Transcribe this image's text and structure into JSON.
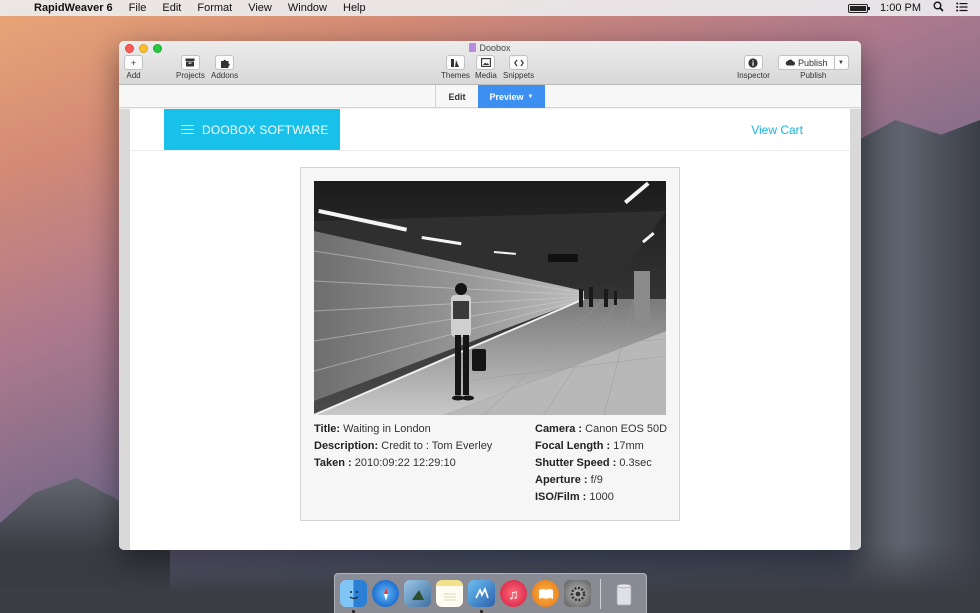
{
  "menubar": {
    "app_name": "RapidWeaver 6",
    "items": [
      "File",
      "Edit",
      "Format",
      "View",
      "Window",
      "Help"
    ],
    "clock": "1:00 PM"
  },
  "window": {
    "title": "Doobox",
    "toolbar": {
      "add": "Add",
      "projects": "Projects",
      "addons": "Addons",
      "themes": "Themes",
      "media": "Media",
      "snippets": "Snippets",
      "inspector": "Inspector",
      "publish_button": "Publish",
      "publish_label": "Publish"
    },
    "modes": {
      "edit": "Edit",
      "preview": "Preview"
    }
  },
  "site": {
    "brand": "DOOBOX SOFTWARE",
    "view_cart": "View Cart",
    "photo": {
      "title_label": "Title:",
      "title": "Waiting in London",
      "description_label": "Description:",
      "description": "Credit to : Tom Everley",
      "taken_label": "Taken :",
      "taken": "2010:09:22 12:29:10",
      "camera_label": "Camera :",
      "camera": "Canon EOS 50D",
      "focal_label": "Focal Length :",
      "focal": "17mm",
      "shutter_label": "Shutter Speed :",
      "shutter": "0.3sec",
      "aperture_label": "Aperture :",
      "aperture": "f/9",
      "iso_label": "ISO/Film :",
      "iso": "1000"
    }
  },
  "colors": {
    "brand": "#17c1ea",
    "preview_tab": "#3d8ff2",
    "link": "#19b3e0"
  },
  "dock": {
    "icons": [
      "finder-icon",
      "safari-icon",
      "preview-icon",
      "notes-icon",
      "rapidweaver-icon",
      "itunes-icon",
      "ibooks-icon",
      "system-preferences-icon",
      "trash-icon"
    ]
  }
}
